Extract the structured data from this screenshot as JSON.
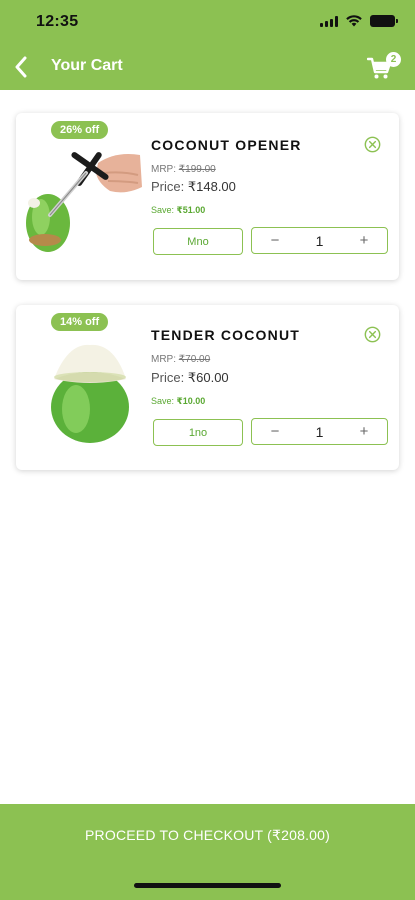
{
  "status_bar": {
    "time": "12:35"
  },
  "header": {
    "title": "Your Cart",
    "cart_count": "2"
  },
  "colors": {
    "brand_green": "#8cc152",
    "save_green": "#5aa832"
  },
  "cart": {
    "items": [
      {
        "discount": "26% off",
        "name": "COCONUT OPENER",
        "mrp_label": "MRP:",
        "mrp": "₹199.00",
        "price_label": "Price:",
        "price": "₹148.00",
        "save_label": "Save:",
        "save": "₹51.00",
        "unit": "Mno",
        "quantity": "1",
        "image": "coconut-opener-image"
      },
      {
        "discount": "14% off",
        "name": "TENDER COCONUT",
        "mrp_label": "MRP:",
        "mrp": "₹70.00",
        "price_label": "Price:",
        "price": "₹60.00",
        "save_label": "Save:",
        "save": "₹10.00",
        "unit": "1no",
        "quantity": "1",
        "image": "tender-coconut-image"
      }
    ],
    "minus_symbol": "−",
    "plus_symbol": "+"
  },
  "checkout": {
    "label": "PROCEED TO CHECKOUT (₹208.00)"
  },
  "icons": {
    "back": "chevron-left-icon",
    "cart": "shopping-cart-icon",
    "remove": "close-circle-icon",
    "signal": "cellular-signal-icon",
    "wifi": "wifi-icon",
    "battery": "battery-icon"
  }
}
